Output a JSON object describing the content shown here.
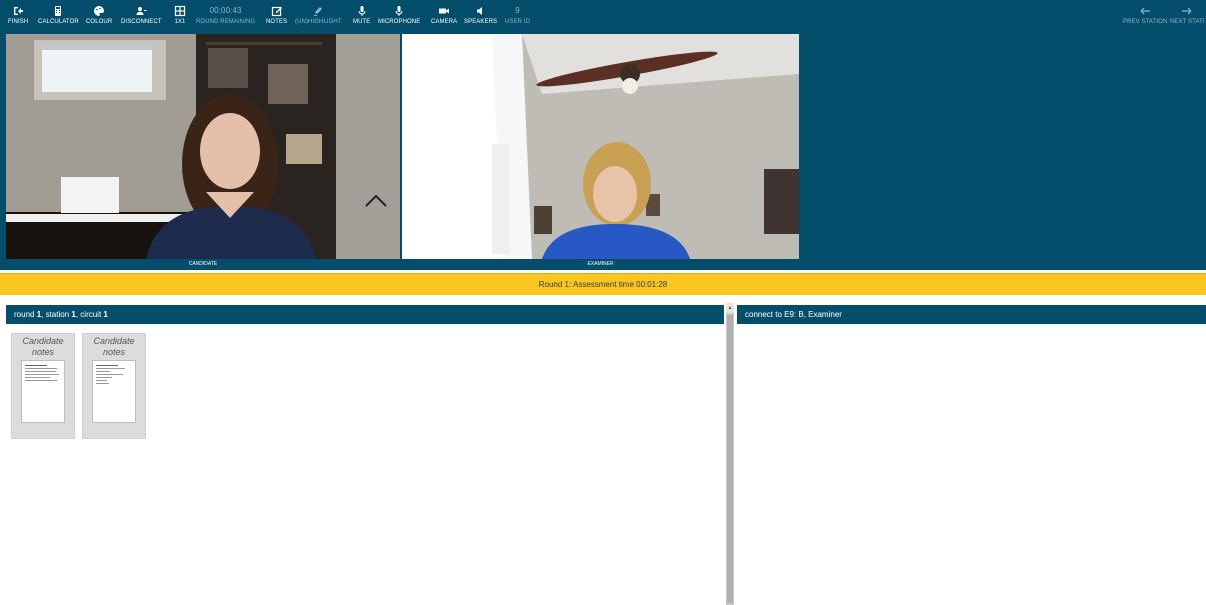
{
  "toolbar": {
    "finish": "FINISH",
    "calculator": "CALCULATOR",
    "colour": "COLOUR",
    "disconnect": "DISCONNECT",
    "layout": "1x1",
    "round_time": "00:00:43",
    "round_remaining": "ROUND REMAINING",
    "notes": "NOTES",
    "highlight": "(UN)HIGHLIGHT",
    "mute": "MUTE",
    "microphone": "MICROPHONE",
    "camera": "CAMERA",
    "speakers": "SPEAKERS",
    "user_id_value": "9",
    "user_id": "USER ID",
    "prev_station": "PREV STATION",
    "next_station": "NEXT STATI"
  },
  "videos": {
    "left_label": "CANDIDATE",
    "right_label": "EXAMINER"
  },
  "assessment_bar": "Round 1: Assessment time 00:01:28",
  "left_panel": {
    "header_prefix_round": "round ",
    "round": "1",
    "header_station": ", station ",
    "station": "1",
    "header_circuit": ", circuit ",
    "circuit": "1",
    "documents": [
      {
        "title": "Candidate notes"
      },
      {
        "title": "Candidate notes"
      }
    ]
  },
  "right_panel": {
    "header": "connect to E9: B, Examiner"
  },
  "colors": {
    "navy": "#054e6b",
    "yellow": "#f9c520"
  }
}
